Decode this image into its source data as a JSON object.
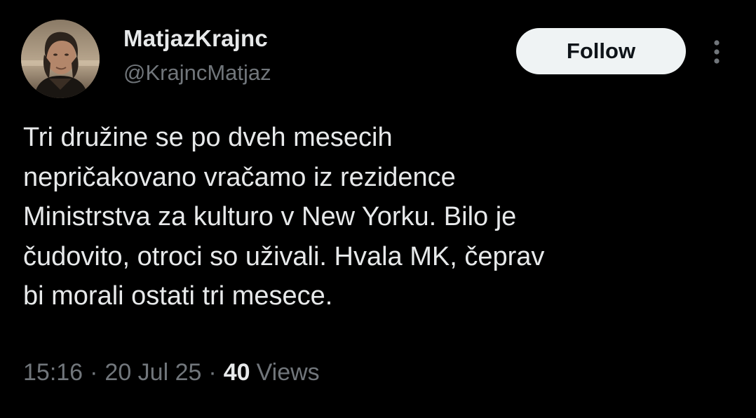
{
  "author": {
    "display_name": "MatjazKrajnc",
    "handle": "@KrajncMatjaz",
    "avatar_icon": "profile-photo"
  },
  "actions": {
    "follow_label": "Follow",
    "more_icon": "more-vertical-icon"
  },
  "tweet": {
    "text": "Tri družine se po dveh mesecih\nnepričakovano vračamo iz rezidence\nMinistrstva za kulturo v New Yorku. Bilo je\nčudovito, otroci so uživali. Hvala MK, čeprav\nbi morali ostati tri mesece."
  },
  "meta": {
    "time": "15:16",
    "separator": "·",
    "date": "20 Jul 25",
    "views_count": "40",
    "views_label": "Views"
  },
  "colors": {
    "background": "#000000",
    "primary_text": "#e7e9ea",
    "secondary_text": "#71767b",
    "follow_button_bg": "#eff3f4",
    "follow_button_text": "#0f1419"
  }
}
